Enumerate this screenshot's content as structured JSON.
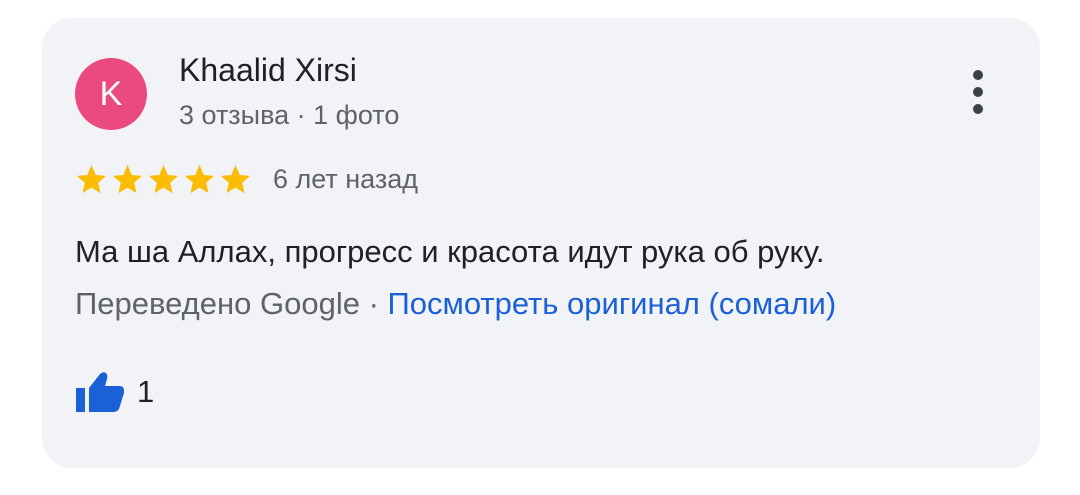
{
  "review": {
    "avatar_letter": "K",
    "avatar_color": "#ea4a7e",
    "author": "Khaalid Xirsi",
    "meta": "3 отзыва · 1 фото",
    "rating": 5,
    "rating_max": 5,
    "time_ago": "6 лет назад",
    "text": "Ма ша Аллах, прогресс и красота идут рука об руку.",
    "translated_by": "Переведено Google",
    "separator": " · ",
    "view_original_link": "Посмотреть оригинал (сомали)",
    "like_count": "1",
    "star_color": "#fbbc04",
    "link_color": "#1a60d6",
    "icons": {
      "more": "more-vert-icon",
      "star": "star-icon",
      "like": "thumbs-up-icon"
    }
  }
}
